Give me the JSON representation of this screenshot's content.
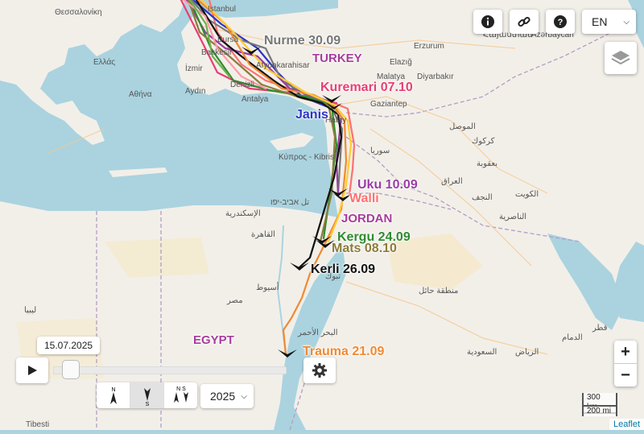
{
  "map": {
    "countries": [
      {
        "key": "turkey",
        "label": "TURKEY",
        "color": "#a63c9a"
      },
      {
        "key": "jordan",
        "label": "JORDAN",
        "color": "#a63c9a"
      },
      {
        "key": "egypt",
        "label": "EGYPT",
        "color": "#a63c9a"
      }
    ],
    "place_labels": [
      "Istanbul",
      "Bursa",
      "Balıkesir",
      "İzmir",
      "Aydın",
      "Denizli",
      "Antalya",
      "Afyonkarahisar",
      "Erzurum",
      "Elazığ",
      "Malatya",
      "Diyarbakır",
      "Gaziantep",
      "Hatay",
      "سوريا",
      "الموصل",
      "كركوك",
      "بعقوبة",
      "العراق",
      "النجف",
      "الناصرية",
      "الكويت",
      "الرياض",
      "السعودية",
      "تبوك",
      "الإسكندرية",
      "القاهرة",
      "مصر",
      "أسيوط",
      "Ελλάς",
      "Αθήνα",
      "Κύπρος - Kibris",
      "ليبيا",
      "Tibesti",
      "Θεσσαλονίκη",
      "Azərbaycan",
      "Հայաստան",
      "تل אביב-יפו",
      "البحر الأحمر",
      "منطقة حائل",
      "الدمام",
      "قطر"
    ],
    "tracks": [
      {
        "name": "Nurme 30.09",
        "color": "#777777"
      },
      {
        "name": "Kuremari 07.10",
        "color": "#e83e73"
      },
      {
        "name": "Janis",
        "color": "#2b33c9"
      },
      {
        "name": "Uku 10.09",
        "color": "#9b3ca6"
      },
      {
        "name": "Walli",
        "color": "#ff7070"
      },
      {
        "name": "Kergu 24.09",
        "color": "#2e8b2e"
      },
      {
        "name": "Mats 08.10",
        "color": "#8b7c3a"
      },
      {
        "name": "Kerli 26.09",
        "color": "#111111"
      },
      {
        "name": "Trauma 21.09",
        "color": "#f08a32"
      }
    ]
  },
  "toolbar": {
    "info_icon": "info-icon",
    "link_icon": "link-icon",
    "help_icon": "help-icon",
    "language": "EN"
  },
  "zoom": {
    "in": "+",
    "out": "−"
  },
  "scale": {
    "km": "300 km",
    "mi": "200 mi"
  },
  "attribution": "Leaflet",
  "timeline": {
    "date": "15.07.2025",
    "year": "2025",
    "progress": 0.02,
    "modes": [
      "N",
      "S",
      "N S"
    ]
  }
}
